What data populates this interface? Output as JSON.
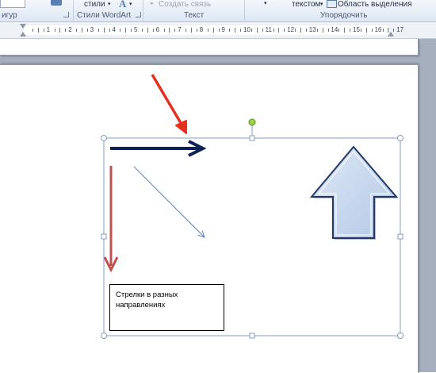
{
  "ribbon": {
    "styles_button": "стили",
    "wordart_group": "Стили WordArt",
    "create_link": "Создать связь",
    "text_group": "Текст",
    "wrap_text": "текстом",
    "selection_pane": "Область выделения",
    "arrange_group": "Упорядочить",
    "shapes_group_partial": "игур"
  },
  "ruler": {
    "labels": [
      "1",
      "2",
      "3",
      "4",
      "5",
      "6",
      "7",
      "8",
      "9",
      "10",
      "11",
      "12",
      "13",
      "14",
      "15",
      "16",
      "17"
    ]
  },
  "document": {
    "textbox_text": "Стрелки в разных направлениях"
  },
  "colors": {
    "navy_arrow": "#0d2157",
    "red_arrow": "#c0504d",
    "blue_thin_arrow": "#6f8fc8",
    "callout_arrow": "#e5301f",
    "up_arrow_fill": "#c6d7ef",
    "up_arrow_stroke": "#1f3864",
    "selection_frame": "#7f9ec4"
  }
}
